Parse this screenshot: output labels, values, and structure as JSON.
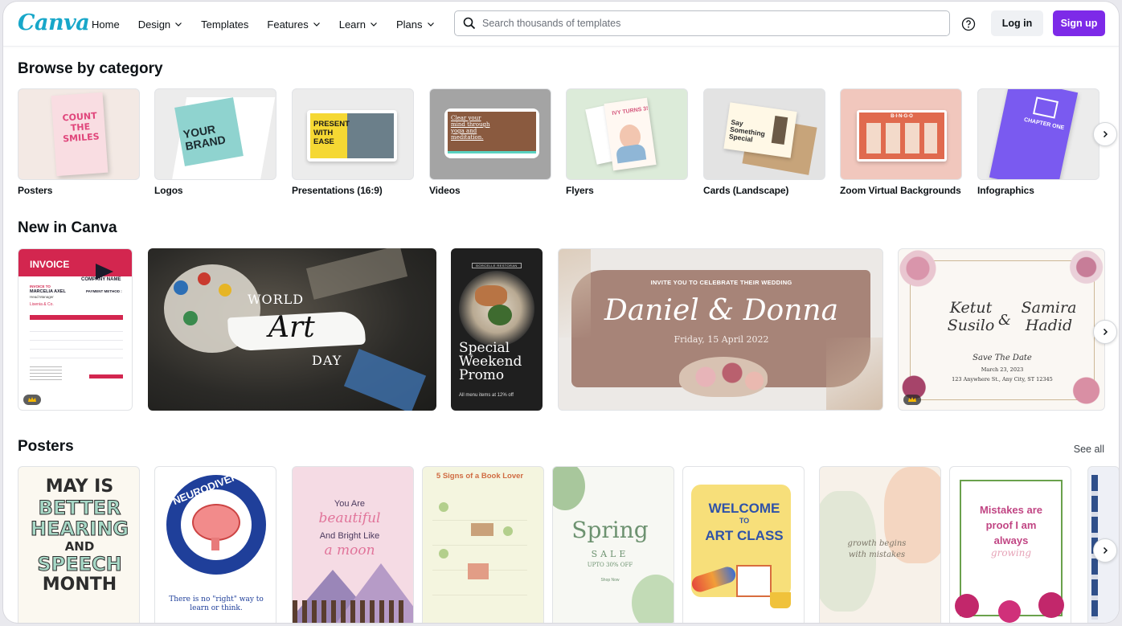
{
  "brand": {
    "logo": "Canva",
    "accent": "#7d2ae8",
    "logo_color": "#18a7c9"
  },
  "nav": [
    {
      "label": "Home",
      "dropdown": false
    },
    {
      "label": "Design",
      "dropdown": true
    },
    {
      "label": "Templates",
      "dropdown": false
    },
    {
      "label": "Features",
      "dropdown": true
    },
    {
      "label": "Learn",
      "dropdown": true
    },
    {
      "label": "Plans",
      "dropdown": true
    }
  ],
  "search": {
    "placeholder": "Search thousands of templates"
  },
  "header_actions": {
    "login": "Log in",
    "signup": "Sign up"
  },
  "sections": {
    "browse": {
      "title": "Browse by category"
    },
    "new": {
      "title": "New in Canva"
    },
    "posters": {
      "title": "Posters",
      "see_all": "See all"
    }
  },
  "categories": [
    {
      "label": "Posters",
      "thumb_text": "COUNT THE SMILES"
    },
    {
      "label": "Logos",
      "thumb_text": "YOUR BRAND"
    },
    {
      "label": "Presentations (16:9)",
      "thumb_text": "PRESENT WITH EASE"
    },
    {
      "label": "Videos",
      "thumb_text": "Clear your mind through yoga and meditation."
    },
    {
      "label": "Flyers",
      "thumb_text": "IVY TURNS 3!"
    },
    {
      "label": "Cards (Landscape)",
      "thumb_text": "Say Something Special"
    },
    {
      "label": "Zoom Virtual Backgrounds",
      "thumb_text": "B·I·N·G·O"
    },
    {
      "label": "Infographics",
      "thumb_text": "CHAPTER ONE"
    }
  ],
  "new_in_canva": {
    "invoice": {
      "title": "INVOICE",
      "company": "COMPANY NAME",
      "invoice_to": "INVOICE TO",
      "name": "MARCELIA AXEL",
      "role": "Head Manager",
      "client": "Lisenia & Co.",
      "payment": "PAYMENT METHOD :"
    },
    "art": {
      "line1": "WORLD",
      "line2": "Art",
      "line3": "DAY"
    },
    "promo": {
      "badge": "BORCELLE RESTORAN",
      "title": "Special Weekend Promo",
      "footer": "All menu items at 12% off"
    },
    "wedding1": {
      "invite": "INVITE YOU TO CELEBRATE THEIR WEDDING",
      "names": "Daniel & Donna",
      "date": "Friday, 15 April 2022"
    },
    "wedding2": {
      "left": "Ketut Susilo",
      "amp": "&",
      "right": "Samira Hadid",
      "save": "Save The Date",
      "date": "March 23, 2023",
      "address": "123 Anywhere St., Any City, ST 12345"
    }
  },
  "posters": [
    {
      "lines": [
        "MAY IS",
        "BETTER",
        "HEARING",
        "AND",
        "SPEECH",
        "MONTH"
      ]
    },
    {
      "title": "NEURODIVERSITY",
      "caption": "There is no \"right\" way to learn or think."
    },
    {
      "line1": "You Are",
      "line2": "beautiful",
      "line3": "And Bright Like",
      "line4": "a moon"
    },
    {
      "title": "5 Signs of a Book Lover"
    },
    {
      "title": "Spring",
      "sub": "SALE",
      "offer": "UPTO 30% OFF",
      "cta": "Shop Now"
    },
    {
      "line1": "WELCOME",
      "line2": "TO",
      "line3": "ART CLASS"
    },
    {
      "line1": "growth begins",
      "line2": "with mistakes"
    },
    {
      "line1": "Mistakes are",
      "line2": "proof I am",
      "line3": "always",
      "line4": "growing"
    }
  ]
}
